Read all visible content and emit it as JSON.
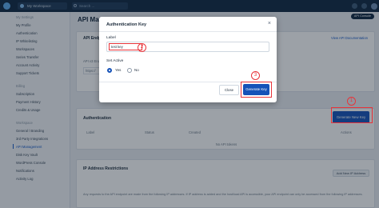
{
  "topbar": {
    "workspace": "My Workspace",
    "search_placeholder": "Search ..."
  },
  "sidebar": {
    "sections": [
      {
        "heading": "My Settings",
        "items": [
          "My Profile",
          "Authentication",
          "IP Whitelisting",
          "Workspaces",
          "Series Transfer",
          "Account Activity",
          "Support Tickets"
        ]
      },
      {
        "heading": "Billing",
        "items": [
          "Subscription",
          "Payment History",
          "Credits & Usage"
        ]
      },
      {
        "heading": "Workspace",
        "items": [
          "General / Branding",
          "3rd Party Integrations",
          "API Management",
          "Disk Key Vault",
          "WordPress Console",
          "Notifications",
          "Activity Log"
        ]
      }
    ],
    "active_item": "API Management"
  },
  "main": {
    "page_title": "API Management",
    "top_pill": "API Console",
    "endpoint_card": {
      "title": "API Endp",
      "doc_link": "View API Documentation",
      "subtitle": "API v3 End",
      "field_value": "https://"
    },
    "auth_card": {
      "title": "Authentication",
      "generate_button": "Generate New Key",
      "columns": [
        "Label",
        "Status",
        "Created",
        "Actions"
      ],
      "empty_text": "No API tokens"
    },
    "ip_card": {
      "title": "IP Address Restrictions",
      "add_button": "Add New IP Address",
      "description": "Any requests to the API endpoint are made from the following IP addresses. If IP address is added and the host/load API is accessible, your API endpoint can only be accessed from the following IP addresses."
    }
  },
  "modal": {
    "title": "Authentication Key",
    "close_glyph": "×",
    "label_field_label": "Label",
    "label_value": "test key",
    "set_active_label": "Set Active",
    "options": [
      "Yes",
      "No"
    ],
    "selected_option": "Yes",
    "cancel_button": "Close",
    "generate_button": "Generate Key"
  },
  "markers": [
    "1",
    "2",
    "3"
  ],
  "colors": {
    "primary": "#1552b8",
    "annotation": "#e8343a",
    "topbar": "#0f2740"
  }
}
